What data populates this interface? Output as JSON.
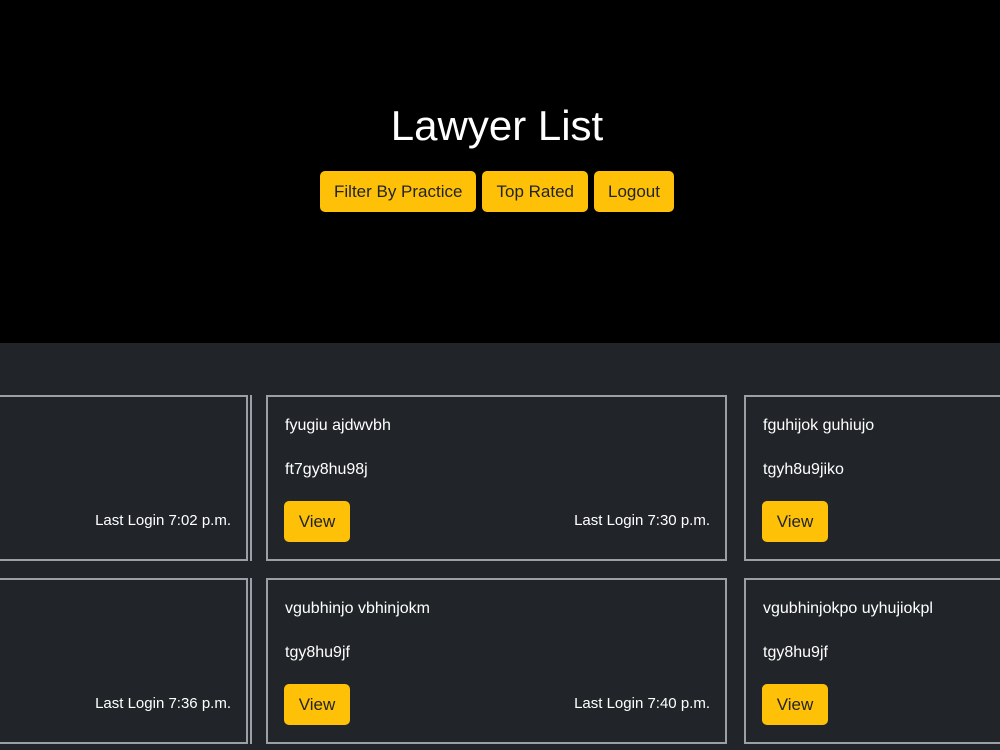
{
  "header": {
    "title": "Lawyer List",
    "buttons": {
      "filter": "Filter By Practice",
      "top_rated": "Top Rated",
      "logout": "Logout"
    }
  },
  "cards": [
    {
      "name": "",
      "id": "",
      "last_login": "Last Login 7:02 p.m."
    },
    {
      "name": "fyugiu ajdwvbh",
      "id": "ft7gy8hu98j",
      "view_label": "View",
      "last_login": "Last Login 7:30 p.m."
    },
    {
      "name": "fguhijok guhiujo",
      "id": "tgyh8u9jiko",
      "view_label": "View"
    },
    {
      "name": "",
      "id": "",
      "last_login": "Last Login 7:36 p.m."
    },
    {
      "name": "vgubhinjo vbhinjokm",
      "id": "tgy8hu9jf",
      "view_label": "View",
      "last_login": "Last Login 7:40 p.m."
    },
    {
      "name": "vgubhinjokpo uyhujiokpl",
      "id": "tgy8hu9jf",
      "view_label": "View"
    }
  ],
  "colors": {
    "accent": "#ffc107",
    "hero_bg": "#000000",
    "page_bg": "#212529",
    "card_border": "#9aa0a6"
  }
}
